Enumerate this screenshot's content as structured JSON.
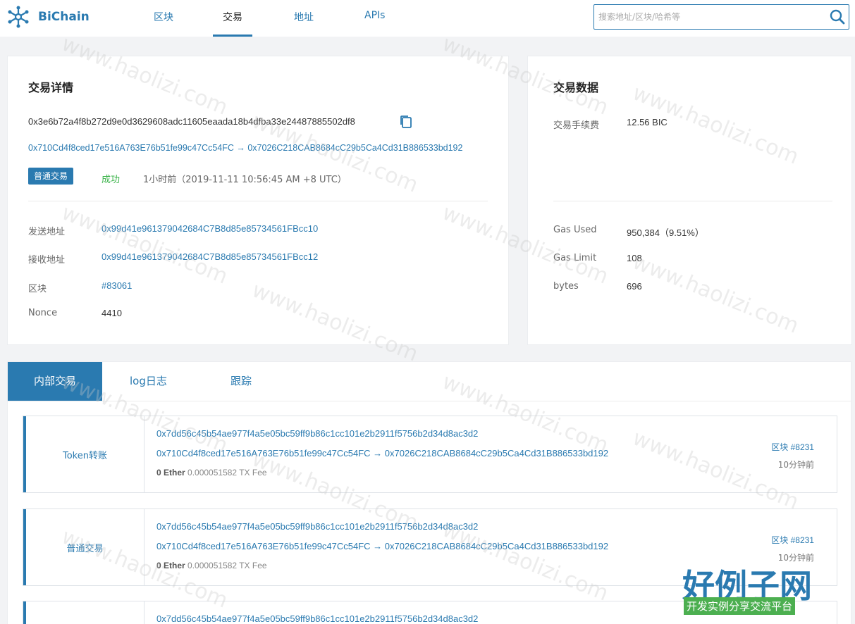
{
  "header": {
    "brand": "BiChain",
    "nav": [
      {
        "label": "区块"
      },
      {
        "label": "交易"
      },
      {
        "label": "地址"
      },
      {
        "label": "APIs"
      }
    ],
    "search_placeholder": "搜索地址/区块/哈希等"
  },
  "details": {
    "title": "交易详情",
    "tx_hash": "0x3e6b72a4f8b272d9e0d3629608adc11605eaada18b4dfba33e24487885502df8",
    "route": "0x710Cd4f8ced17e516A763E76b51fe99c47Cc54FC → 0x7026C218CAB8684cC29b5Ca4Cd31B886533bd192",
    "tag": "普通交易",
    "status": "成功",
    "time": "1小时前（2019-11-11 10:56:45 AM +8 UTC）",
    "fields": [
      {
        "label": "发送地址",
        "value": "0x99d41e961379042684C7B8d85e85734561FBcc10"
      },
      {
        "label": "接收地址",
        "value": "0x99d41e961379042684C7B8d85e85734561FBcc12"
      },
      {
        "label": "区块",
        "value": "#83061"
      },
      {
        "label": "Nonce",
        "value": "4410"
      }
    ]
  },
  "txdata": {
    "title": "交易数据",
    "fee_label": "交易手续费",
    "fee_value": "12.56 BIC",
    "fields": [
      {
        "label": "Gas Used",
        "value": "950,384（9.51%）"
      },
      {
        "label": "Gas Limit",
        "value": "108"
      },
      {
        "label": "bytes",
        "value": "696"
      }
    ]
  },
  "tabs": [
    {
      "label": "内部交易"
    },
    {
      "label": "log日志"
    },
    {
      "label": "跟踪"
    }
  ],
  "transactions": [
    {
      "type": "Token转账",
      "hash": "0x7dd56c45b54ae977f4a5e05bc59ff9b86c1cc101e2b2911f5756b2d34d8ac3d2",
      "route": "0x710Cd4f8ced17e516A763E76b51fe99c47Cc54FC → 0x7026C218CAB8684cC29b5Ca4Cd31B886533bd192",
      "amount": "0 Ether",
      "fee": "0.000051582 TX Fee",
      "block": "区块 #8231",
      "ago": "10分钟前"
    },
    {
      "type": "普通交易",
      "hash": "0x7dd56c45b54ae977f4a5e05bc59ff9b86c1cc101e2b2911f5756b2d34d8ac3d2",
      "route": "0x710Cd4f8ced17e516A763E76b51fe99c47Cc54FC → 0x7026C218CAB8684cC29b5Ca4Cd31B886533bd192",
      "amount": "0 Ether",
      "fee": "0.000051582 TX Fee",
      "block": "区块 #8231",
      "ago": "10分钟前"
    },
    {
      "type": "",
      "hash": "0x7dd56c45b54ae977f4a5e05bc59ff9b86c1cc101e2b2911f5756b2d34d8ac3d2",
      "route": "",
      "amount": "",
      "fee": "",
      "block": "",
      "ago": ""
    }
  ],
  "watermark": {
    "text": "www.haolizi.com",
    "brand_big": "好例子网",
    "brand_small": "开发实例分享交流平台"
  },
  "colors": {
    "accent": "#2a7ab0",
    "success": "#3bb34a",
    "background": "#f2f3f5"
  }
}
